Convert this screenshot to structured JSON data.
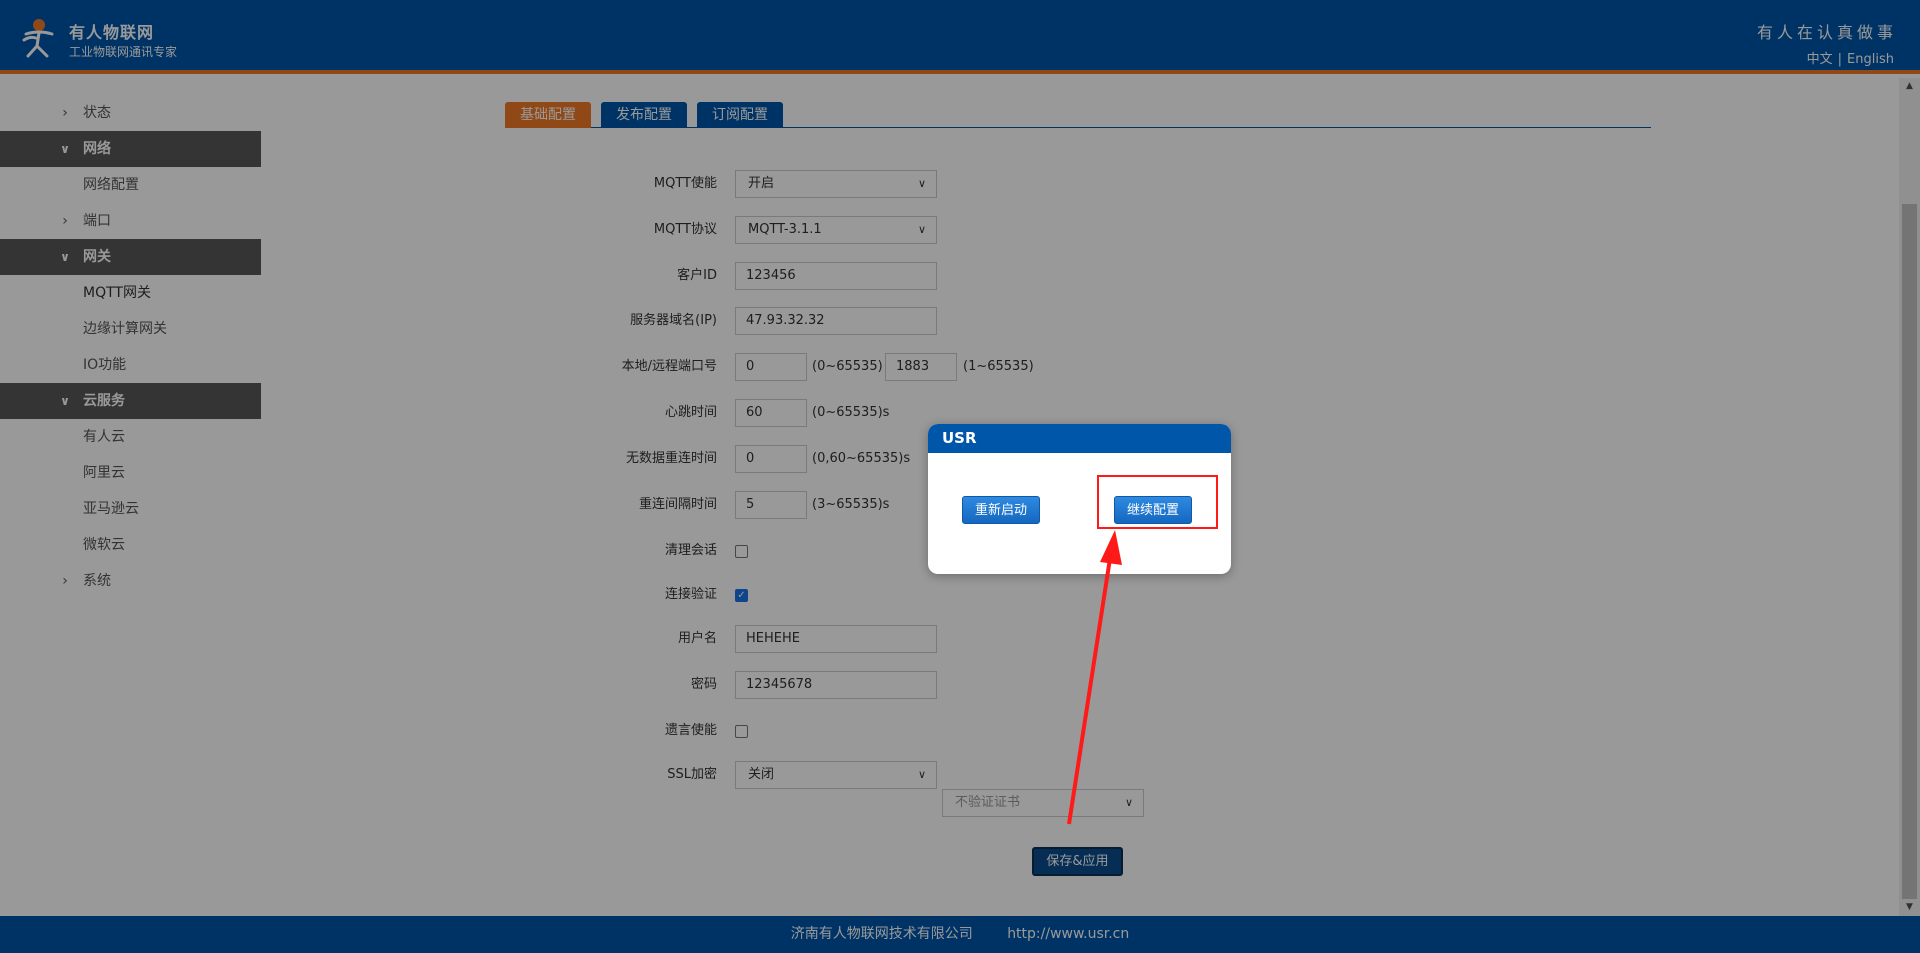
{
  "header": {
    "brand_name": "有人物联网",
    "brand_sub": "工业物联网通讯专家",
    "slogan": "有人在认真做事",
    "lang_cn": "中文",
    "lang_sep": "|",
    "lang_en": "English"
  },
  "sidebar": {
    "items": [
      {
        "label": "状态"
      },
      {
        "label": "网络"
      },
      {
        "label": "网络配置"
      },
      {
        "label": "端口"
      },
      {
        "label": "网关"
      },
      {
        "label": "MQTT网关"
      },
      {
        "label": "边缘计算网关"
      },
      {
        "label": "IO功能"
      },
      {
        "label": "云服务"
      },
      {
        "label": "有人云"
      },
      {
        "label": "阿里云"
      },
      {
        "label": "亚马逊云"
      },
      {
        "label": "微软云"
      },
      {
        "label": "系统"
      }
    ]
  },
  "tabs": [
    "基础配置",
    "发布配置",
    "订阅配置"
  ],
  "form": {
    "mqtt_enable": {
      "label": "MQTT使能",
      "value": "开启"
    },
    "mqtt_protocol": {
      "label": "MQTT协议",
      "value": "MQTT-3.1.1"
    },
    "client_id": {
      "label": "客户ID",
      "value": "123456"
    },
    "server": {
      "label": "服务器域名(IP)",
      "value": "47.93.32.32"
    },
    "ports": {
      "label": "本地/远程端口号",
      "local": "0",
      "local_hint": "(0~65535)",
      "remote": "1883",
      "remote_hint": "(1~65535)"
    },
    "heartbeat": {
      "label": "心跳时间",
      "value": "60",
      "hint": "(0~65535)s"
    },
    "no_data_reconnect": {
      "label": "无数据重连时间",
      "value": "0",
      "hint": "(0,60~65535)s"
    },
    "reconnect_interval": {
      "label": "重连间隔时间",
      "value": "5",
      "hint": "(3~65535)s"
    },
    "clean_session": {
      "label": "清理会话",
      "checked": false
    },
    "auth": {
      "label": "连接验证",
      "checked": true
    },
    "username": {
      "label": "用户名",
      "value": "HEHEHE"
    },
    "password": {
      "label": "密码",
      "value": "12345678"
    },
    "will_enable": {
      "label": "遗言使能",
      "checked": false
    },
    "ssl": {
      "label": "SSL加密",
      "value": "关闭",
      "cert": "不验证证书"
    }
  },
  "save_button": "保存&应用",
  "footer": {
    "company": "济南有人物联网技术有限公司",
    "url": "http://www.usr.cn"
  },
  "modal": {
    "title": "USR",
    "restart": "重新启动",
    "continue": "继续配置"
  },
  "colors": {
    "brand_blue": "#0056a8",
    "accent_orange": "#f07a26",
    "highlight_red": "#ff1a1a"
  }
}
